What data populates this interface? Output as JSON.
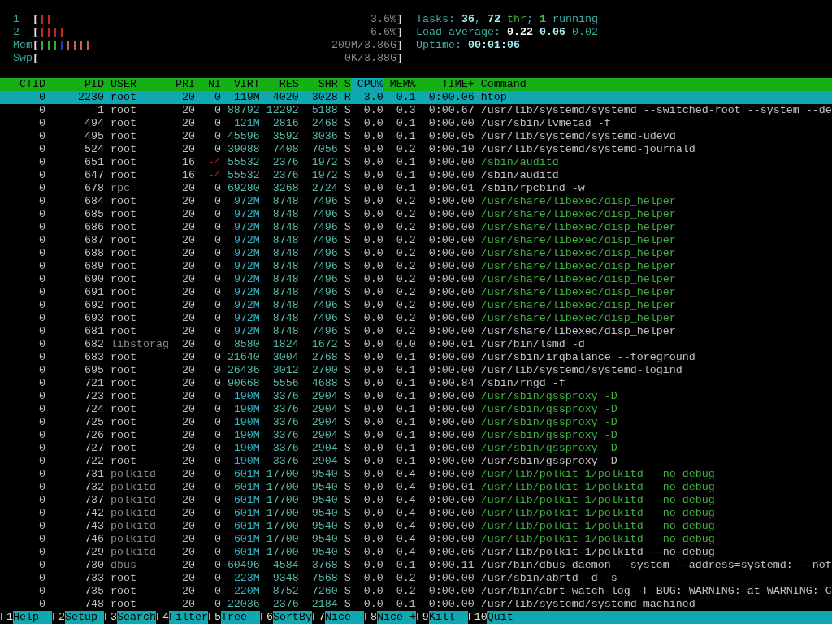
{
  "meters": [
    {
      "label": "1",
      "open": "[",
      "segments": [
        {
          "level": 0.037,
          "color": "#c02828"
        }
      ],
      "value": "3.6%",
      "close": "]"
    },
    {
      "label": "2",
      "open": "[",
      "segments": [
        {
          "level": 0.074,
          "color": "#c02828"
        }
      ],
      "value": "6.6%",
      "close": "]"
    },
    {
      "label": "Mem",
      "open": "[",
      "segments": [
        {
          "level": 0.056,
          "color": "#3aa83a"
        },
        {
          "level": 0.019,
          "color": "#2838b8"
        },
        {
          "level": 0.074,
          "color": "#c86848"
        }
      ],
      "value": "209M/3.86G",
      "close": "]"
    },
    {
      "label": "Swp",
      "open": "[",
      "value": "0K/3.88G",
      "close": "]"
    }
  ],
  "summary": [
    [
      {
        "text": "Tasks: ",
        "kind": "label"
      },
      {
        "text": "36",
        "kind": "value"
      },
      {
        "text": ", ",
        "kind": "label"
      },
      {
        "text": "72",
        "kind": "value"
      },
      {
        "text": " thr",
        "kind": "thread"
      },
      {
        "text": "; ",
        "kind": "label"
      },
      {
        "text": "1",
        "kind": "running"
      },
      {
        "text": " running",
        "kind": "label"
      }
    ],
    [
      {
        "text": "Load average: ",
        "kind": "label"
      },
      {
        "text": "0.22",
        "kind": "strong"
      },
      {
        "text": " 0.06",
        "kind": "value"
      },
      {
        "text": " 0.02",
        "kind": "label"
      }
    ],
    [
      {
        "text": "Uptime: ",
        "kind": "label"
      },
      {
        "text": "00:01:06",
        "kind": "value"
      }
    ]
  ],
  "columns": [
    {
      "label": "CTID",
      "sorted": false
    },
    {
      "label": "PID",
      "sorted": false
    },
    {
      "label": "USER",
      "sorted": false
    },
    {
      "label": "PRI",
      "sorted": false
    },
    {
      "label": "NI",
      "sorted": false
    },
    {
      "label": "VIRT",
      "sorted": false
    },
    {
      "label": "RES",
      "sorted": false
    },
    {
      "label": "SHR",
      "sorted": false
    },
    {
      "label": "S",
      "sorted": false
    },
    {
      "label": "CPU%",
      "sorted": true
    },
    {
      "label": "MEM%",
      "sorted": false
    },
    {
      "label": "TIME+",
      "sorted": false
    },
    {
      "label": "Command",
      "sorted": false
    }
  ],
  "rows": [
    {
      "cells": [
        "0",
        "2230",
        "root",
        "20",
        "0",
        "119M",
        "4020",
        "3028",
        "R",
        "3.0",
        "0.1",
        "0:00.06",
        "htop"
      ],
      "selected": true,
      "thread": false,
      "other_user": false,
      "niced": false
    },
    {
      "cells": [
        "0",
        "1",
        "root",
        "20",
        "0",
        "88792",
        "12292",
        "5188",
        "S",
        "0.0",
        "0.3",
        "0:00.67",
        "/usr/lib/systemd/systemd --switched-root --system --de"
      ],
      "selected": false,
      "thread": false,
      "other_user": false,
      "niced": false
    },
    {
      "cells": [
        "0",
        "494",
        "root",
        "20",
        "0",
        "121M",
        "2816",
        "2468",
        "S",
        "0.0",
        "0.1",
        "0:00.00",
        "/usr/sbin/lvmetad -f"
      ],
      "selected": false,
      "thread": false,
      "other_user": false,
      "niced": false
    },
    {
      "cells": [
        "0",
        "495",
        "root",
        "20",
        "0",
        "45596",
        "3592",
        "3036",
        "S",
        "0.0",
        "0.1",
        "0:00.05",
        "/usr/lib/systemd/systemd-udevd"
      ],
      "selected": false,
      "thread": false,
      "other_user": false,
      "niced": false
    },
    {
      "cells": [
        "0",
        "524",
        "root",
        "20",
        "0",
        "39088",
        "7408",
        "7056",
        "S",
        "0.0",
        "0.2",
        "0:00.10",
        "/usr/lib/systemd/systemd-journald"
      ],
      "selected": false,
      "thread": false,
      "other_user": false,
      "niced": false
    },
    {
      "cells": [
        "0",
        "651",
        "root",
        "16",
        "-4",
        "55532",
        "2376",
        "1972",
        "S",
        "0.0",
        "0.1",
        "0:00.00",
        "/sbin/auditd"
      ],
      "selected": false,
      "thread": true,
      "other_user": false,
      "niced": true
    },
    {
      "cells": [
        "0",
        "647",
        "root",
        "16",
        "-4",
        "55532",
        "2376",
        "1972",
        "S",
        "0.0",
        "0.1",
        "0:00.00",
        "/sbin/auditd"
      ],
      "selected": false,
      "thread": false,
      "other_user": false,
      "niced": true
    },
    {
      "cells": [
        "0",
        "678",
        "rpc",
        "20",
        "0",
        "69280",
        "3268",
        "2724",
        "S",
        "0.0",
        "0.1",
        "0:00.01",
        "/sbin/rpcbind -w"
      ],
      "selected": false,
      "thread": false,
      "other_user": true,
      "niced": false
    },
    {
      "cells": [
        "0",
        "684",
        "root",
        "20",
        "0",
        "972M",
        "8748",
        "7496",
        "S",
        "0.0",
        "0.2",
        "0:00.00",
        "/usr/share/libexec/disp_helper"
      ],
      "selected": false,
      "thread": true,
      "other_user": false,
      "niced": false
    },
    {
      "cells": [
        "0",
        "685",
        "root",
        "20",
        "0",
        "972M",
        "8748",
        "7496",
        "S",
        "0.0",
        "0.2",
        "0:00.00",
        "/usr/share/libexec/disp_helper"
      ],
      "selected": false,
      "thread": true,
      "other_user": false,
      "niced": false
    },
    {
      "cells": [
        "0",
        "686",
        "root",
        "20",
        "0",
        "972M",
        "8748",
        "7496",
        "S",
        "0.0",
        "0.2",
        "0:00.00",
        "/usr/share/libexec/disp_helper"
      ],
      "selected": false,
      "thread": true,
      "other_user": false,
      "niced": false
    },
    {
      "cells": [
        "0",
        "687",
        "root",
        "20",
        "0",
        "972M",
        "8748",
        "7496",
        "S",
        "0.0",
        "0.2",
        "0:00.00",
        "/usr/share/libexec/disp_helper"
      ],
      "selected": false,
      "thread": true,
      "other_user": false,
      "niced": false
    },
    {
      "cells": [
        "0",
        "688",
        "root",
        "20",
        "0",
        "972M",
        "8748",
        "7496",
        "S",
        "0.0",
        "0.2",
        "0:00.00",
        "/usr/share/libexec/disp_helper"
      ],
      "selected": false,
      "thread": true,
      "other_user": false,
      "niced": false
    },
    {
      "cells": [
        "0",
        "689",
        "root",
        "20",
        "0",
        "972M",
        "8748",
        "7496",
        "S",
        "0.0",
        "0.2",
        "0:00.00",
        "/usr/share/libexec/disp_helper"
      ],
      "selected": false,
      "thread": true,
      "other_user": false,
      "niced": false
    },
    {
      "cells": [
        "0",
        "690",
        "root",
        "20",
        "0",
        "972M",
        "8748",
        "7496",
        "S",
        "0.0",
        "0.2",
        "0:00.00",
        "/usr/share/libexec/disp_helper"
      ],
      "selected": false,
      "thread": true,
      "other_user": false,
      "niced": false
    },
    {
      "cells": [
        "0",
        "691",
        "root",
        "20",
        "0",
        "972M",
        "8748",
        "7496",
        "S",
        "0.0",
        "0.2",
        "0:00.00",
        "/usr/share/libexec/disp_helper"
      ],
      "selected": false,
      "thread": true,
      "other_user": false,
      "niced": false
    },
    {
      "cells": [
        "0",
        "692",
        "root",
        "20",
        "0",
        "972M",
        "8748",
        "7496",
        "S",
        "0.0",
        "0.2",
        "0:00.00",
        "/usr/share/libexec/disp_helper"
      ],
      "selected": false,
      "thread": true,
      "other_user": false,
      "niced": false
    },
    {
      "cells": [
        "0",
        "693",
        "root",
        "20",
        "0",
        "972M",
        "8748",
        "7496",
        "S",
        "0.0",
        "0.2",
        "0:00.00",
        "/usr/share/libexec/disp_helper"
      ],
      "selected": false,
      "thread": true,
      "other_user": false,
      "niced": false
    },
    {
      "cells": [
        "0",
        "681",
        "root",
        "20",
        "0",
        "972M",
        "8748",
        "7496",
        "S",
        "0.0",
        "0.2",
        "0:00.00",
        "/usr/share/libexec/disp_helper"
      ],
      "selected": false,
      "thread": false,
      "other_user": false,
      "niced": false
    },
    {
      "cells": [
        "0",
        "682",
        "libstorag",
        "20",
        "0",
        "8580",
        "1824",
        "1672",
        "S",
        "0.0",
        "0.0",
        "0:00.01",
        "/usr/bin/lsmd -d"
      ],
      "selected": false,
      "thread": false,
      "other_user": true,
      "niced": false
    },
    {
      "cells": [
        "0",
        "683",
        "root",
        "20",
        "0",
        "21640",
        "3004",
        "2768",
        "S",
        "0.0",
        "0.1",
        "0:00.00",
        "/usr/sbin/irqbalance --foreground"
      ],
      "selected": false,
      "thread": false,
      "other_user": false,
      "niced": false
    },
    {
      "cells": [
        "0",
        "695",
        "root",
        "20",
        "0",
        "26436",
        "3012",
        "2700",
        "S",
        "0.0",
        "0.1",
        "0:00.00",
        "/usr/lib/systemd/systemd-logind"
      ],
      "selected": false,
      "thread": false,
      "other_user": false,
      "niced": false
    },
    {
      "cells": [
        "0",
        "721",
        "root",
        "20",
        "0",
        "90668",
        "5556",
        "4688",
        "S",
        "0.0",
        "0.1",
        "0:00.84",
        "/sbin/rngd -f"
      ],
      "selected": false,
      "thread": false,
      "other_user": false,
      "niced": false
    },
    {
      "cells": [
        "0",
        "723",
        "root",
        "20",
        "0",
        "190M",
        "3376",
        "2904",
        "S",
        "0.0",
        "0.1",
        "0:00.00",
        "/usr/sbin/gssproxy -D"
      ],
      "selected": false,
      "thread": true,
      "other_user": false,
      "niced": false
    },
    {
      "cells": [
        "0",
        "724",
        "root",
        "20",
        "0",
        "190M",
        "3376",
        "2904",
        "S",
        "0.0",
        "0.1",
        "0:00.00",
        "/usr/sbin/gssproxy -D"
      ],
      "selected": false,
      "thread": true,
      "other_user": false,
      "niced": false
    },
    {
      "cells": [
        "0",
        "725",
        "root",
        "20",
        "0",
        "190M",
        "3376",
        "2904",
        "S",
        "0.0",
        "0.1",
        "0:00.00",
        "/usr/sbin/gssproxy -D"
      ],
      "selected": false,
      "thread": true,
      "other_user": false,
      "niced": false
    },
    {
      "cells": [
        "0",
        "726",
        "root",
        "20",
        "0",
        "190M",
        "3376",
        "2904",
        "S",
        "0.0",
        "0.1",
        "0:00.00",
        "/usr/sbin/gssproxy -D"
      ],
      "selected": false,
      "thread": true,
      "other_user": false,
      "niced": false
    },
    {
      "cells": [
        "0",
        "727",
        "root",
        "20",
        "0",
        "190M",
        "3376",
        "2904",
        "S",
        "0.0",
        "0.1",
        "0:00.00",
        "/usr/sbin/gssproxy -D"
      ],
      "selected": false,
      "thread": true,
      "other_user": false,
      "niced": false
    },
    {
      "cells": [
        "0",
        "722",
        "root",
        "20",
        "0",
        "190M",
        "3376",
        "2904",
        "S",
        "0.0",
        "0.1",
        "0:00.00",
        "/usr/sbin/gssproxy -D"
      ],
      "selected": false,
      "thread": false,
      "other_user": false,
      "niced": false
    },
    {
      "cells": [
        "0",
        "731",
        "polkitd",
        "20",
        "0",
        "601M",
        "17700",
        "9540",
        "S",
        "0.0",
        "0.4",
        "0:00.00",
        "/usr/lib/polkit-1/polkitd --no-debug"
      ],
      "selected": false,
      "thread": true,
      "other_user": true,
      "niced": false
    },
    {
      "cells": [
        "0",
        "732",
        "polkitd",
        "20",
        "0",
        "601M",
        "17700",
        "9540",
        "S",
        "0.0",
        "0.4",
        "0:00.01",
        "/usr/lib/polkit-1/polkitd --no-debug"
      ],
      "selected": false,
      "thread": true,
      "other_user": true,
      "niced": false
    },
    {
      "cells": [
        "0",
        "737",
        "polkitd",
        "20",
        "0",
        "601M",
        "17700",
        "9540",
        "S",
        "0.0",
        "0.4",
        "0:00.00",
        "/usr/lib/polkit-1/polkitd --no-debug"
      ],
      "selected": false,
      "thread": true,
      "other_user": true,
      "niced": false
    },
    {
      "cells": [
        "0",
        "742",
        "polkitd",
        "20",
        "0",
        "601M",
        "17700",
        "9540",
        "S",
        "0.0",
        "0.4",
        "0:00.00",
        "/usr/lib/polkit-1/polkitd --no-debug"
      ],
      "selected": false,
      "thread": true,
      "other_user": true,
      "niced": false
    },
    {
      "cells": [
        "0",
        "743",
        "polkitd",
        "20",
        "0",
        "601M",
        "17700",
        "9540",
        "S",
        "0.0",
        "0.4",
        "0:00.00",
        "/usr/lib/polkit-1/polkitd --no-debug"
      ],
      "selected": false,
      "thread": true,
      "other_user": true,
      "niced": false
    },
    {
      "cells": [
        "0",
        "746",
        "polkitd",
        "20",
        "0",
        "601M",
        "17700",
        "9540",
        "S",
        "0.0",
        "0.4",
        "0:00.00",
        "/usr/lib/polkit-1/polkitd --no-debug"
      ],
      "selected": false,
      "thread": true,
      "other_user": true,
      "niced": false
    },
    {
      "cells": [
        "0",
        "729",
        "polkitd",
        "20",
        "0",
        "601M",
        "17700",
        "9540",
        "S",
        "0.0",
        "0.4",
        "0:00.06",
        "/usr/lib/polkit-1/polkitd --no-debug"
      ],
      "selected": false,
      "thread": false,
      "other_user": true,
      "niced": false
    },
    {
      "cells": [
        "0",
        "730",
        "dbus",
        "20",
        "0",
        "60496",
        "4584",
        "3768",
        "S",
        "0.0",
        "0.1",
        "0:00.11",
        "/usr/bin/dbus-daemon --system --address=systemd: --nof"
      ],
      "selected": false,
      "thread": false,
      "other_user": true,
      "niced": false
    },
    {
      "cells": [
        "0",
        "733",
        "root",
        "20",
        "0",
        "223M",
        "9348",
        "7568",
        "S",
        "0.0",
        "0.2",
        "0:00.00",
        "/usr/sbin/abrtd -d -s"
      ],
      "selected": false,
      "thread": false,
      "other_user": false,
      "niced": false
    },
    {
      "cells": [
        "0",
        "735",
        "root",
        "20",
        "0",
        "220M",
        "8752",
        "7260",
        "S",
        "0.0",
        "0.2",
        "0:00.00",
        "/usr/bin/abrt-watch-log -F BUG: WARNING: at WARNING: C"
      ],
      "selected": false,
      "thread": false,
      "other_user": false,
      "niced": false
    },
    {
      "cells": [
        "0",
        "748",
        "root",
        "20",
        "0",
        "22036",
        "2376",
        "2184",
        "S",
        "0.0",
        "0.1",
        "0:00.00",
        "/usr/lib/systemd/systemd-machined"
      ],
      "selected": false,
      "thread": false,
      "other_user": false,
      "niced": false
    }
  ],
  "function_keys": [
    {
      "key": "F1",
      "label": "Help"
    },
    {
      "key": "F2",
      "label": "Setup"
    },
    {
      "key": "F3",
      "label": "Search"
    },
    {
      "key": "F4",
      "label": "Filter"
    },
    {
      "key": "F5",
      "label": "Tree"
    },
    {
      "key": "F6",
      "label": "SortBy"
    },
    {
      "key": "F7",
      "label": "Nice -"
    },
    {
      "key": "F8",
      "label": "Nice +"
    },
    {
      "key": "F9",
      "label": "Kill"
    },
    {
      "key": "F10",
      "label": "Quit"
    }
  ]
}
